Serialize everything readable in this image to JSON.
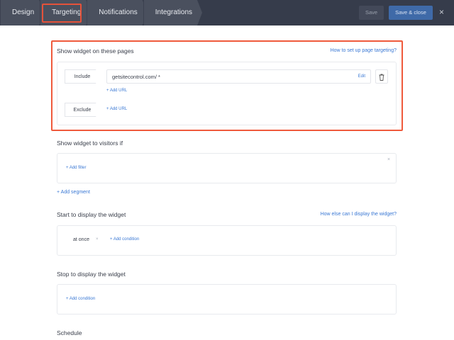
{
  "topbar": {
    "tabs": [
      {
        "label": "Design"
      },
      {
        "label": "Targeting"
      },
      {
        "label": "Notifications"
      },
      {
        "label": "Integrations"
      }
    ],
    "active_tab": "Targeting",
    "save_label": "Save",
    "save_close_label": "Save & close",
    "close_icon": "×"
  },
  "pages": {
    "title": "Show widget on these pages",
    "help_link": "How to set up page targeting?",
    "include_label": "Include",
    "include_url": "getsitecontrol.com/ *",
    "edit_label": "Edit",
    "add_url_label": "+ Add URL",
    "exclude_label": "Exclude",
    "exclude_add_url_label": "+ Add URL"
  },
  "visitors": {
    "title": "Show widget to visitors if",
    "add_filter": "+ Add filter",
    "remove": "×",
    "add_segment": "+ Add segment"
  },
  "start": {
    "title": "Start to display the widget",
    "help_link": "How else can I display the widget?",
    "condition": "at once",
    "remove": "×",
    "add_condition": "+ Add condition"
  },
  "stop": {
    "title": "Stop to display the widget",
    "add_condition": "+ Add condition"
  },
  "schedule": {
    "title": "Schedule"
  },
  "colors": {
    "topbar": "#363c4b",
    "accent": "#3a78d4",
    "highlight": "#ef5a3c"
  }
}
